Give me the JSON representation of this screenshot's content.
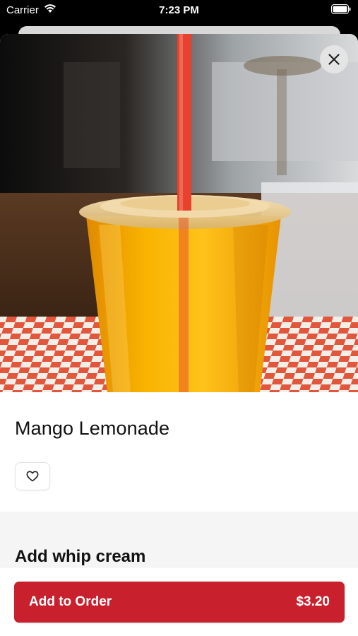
{
  "status_bar": {
    "carrier": "Carrier",
    "time": "7:23 PM"
  },
  "product": {
    "name": "Mango Lemonade",
    "image_icon": "mango-lemonade-photo"
  },
  "options": {
    "heading": "Add whip cream"
  },
  "order": {
    "button_label": "Add to Order",
    "price": "$3.20"
  },
  "colors": {
    "accent": "#c8202d",
    "drink": "#f5a800",
    "straw": "#e8422e"
  }
}
